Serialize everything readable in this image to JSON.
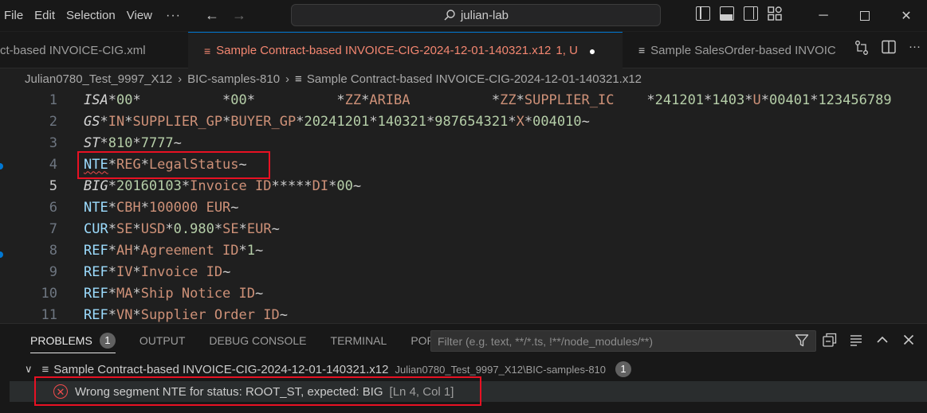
{
  "menu": [
    "File",
    "Edit",
    "Selection",
    "View"
  ],
  "more_label": "···",
  "search": {
    "text": "julian-lab"
  },
  "tabs": [
    {
      "label": "ct-based INVOICE-CIG.xml"
    },
    {
      "label": "Sample Contract-based INVOICE-CIG-2024-12-01-140321.x12",
      "status": "1, U"
    },
    {
      "label": "Sample SalesOrder-based INVOIC"
    }
  ],
  "breadcrumb": [
    "Julian0780_Test_9997_X12",
    "BIC-samples-810",
    "Sample Contract-based INVOICE-CIG-2024-12-01-140321.x12"
  ],
  "editor": {
    "lines": [
      {
        "num": "1"
      },
      {
        "num": "2"
      },
      {
        "num": "3"
      },
      {
        "num": "4"
      },
      {
        "num": "5"
      },
      {
        "num": "6"
      },
      {
        "num": "7"
      },
      {
        "num": "8"
      },
      {
        "num": "9"
      },
      {
        "num": "10"
      },
      {
        "num": "11"
      }
    ]
  },
  "panel": {
    "tabs": [
      "PROBLEMS",
      "OUTPUT",
      "DEBUG CONSOLE",
      "TERMINAL",
      "PORTS"
    ],
    "problems_count": "1",
    "filter_placeholder": "Filter (e.g. text, **/*.ts, !**/node_modules/**)",
    "file": {
      "name": "Sample Contract-based INVOICE-CIG-2024-12-01-140321.x12",
      "path": "Julian0780_Test_9997_X12\\BIC-samples-810",
      "count": "1"
    },
    "error": {
      "message": "Wrong segment NTE for status: ROOT_ST, expected: BIG",
      "location": "[Ln 4, Col 1]"
    }
  },
  "colors": {
    "accent": "#0078d4",
    "error": "#f14c4c",
    "highlight": "#e81123",
    "tab_modified": "#f48771"
  }
}
